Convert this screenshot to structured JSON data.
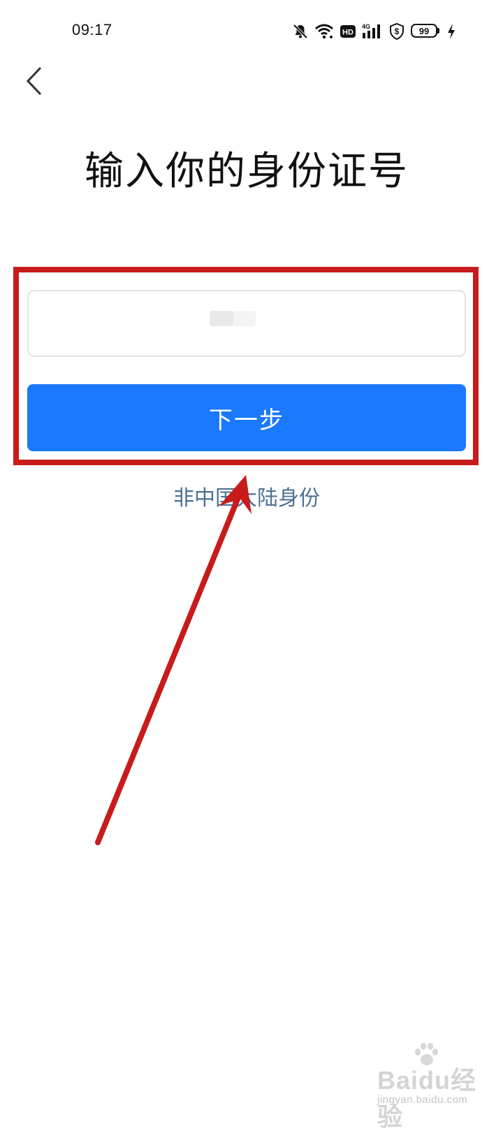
{
  "status_bar": {
    "time": "09:17",
    "icons": [
      "bell-off-icon",
      "wifi-icon",
      "hd-icon",
      "4g-signal-icon",
      "shield-dollar-icon",
      "battery-icon",
      "charging-icon"
    ],
    "hd_label": "HD",
    "network_label": "4G",
    "battery_level": "99"
  },
  "header": {
    "back_icon": "chevron-left-icon"
  },
  "main": {
    "title": "输入你的身份证号",
    "id_input": {
      "value": "",
      "placeholder": ""
    },
    "next_button_label": "下一步",
    "alt_link_label": "非中国大陆身份"
  },
  "annotation": {
    "highlight_color": "#c81b1b",
    "arrow_color": "#c81b1b"
  },
  "watermark": {
    "logo_text": "Baidu经验",
    "sub_text": "jingyan.baidu.com"
  },
  "colors": {
    "primary": "#1a79ff",
    "link": "#4f6f94"
  }
}
